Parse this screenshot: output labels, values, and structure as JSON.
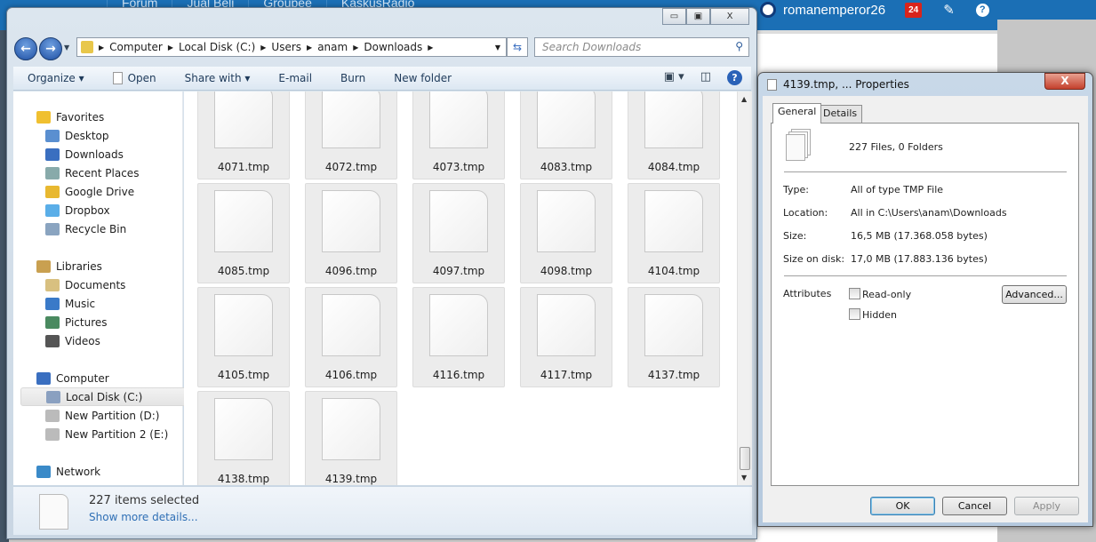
{
  "browser": {
    "nav": [
      "Forum",
      "Jual Beli",
      "Groupee",
      "KaskusRadio"
    ],
    "username": "romanemperor26",
    "notification_count": "24"
  },
  "explorer": {
    "caption_buttons": {
      "minimize": "▭",
      "maximize": "▣",
      "close": "X"
    },
    "breadcrumb": [
      "Computer",
      "Local Disk (C:)",
      "Users",
      "anam",
      "Downloads"
    ],
    "search_placeholder": "Search Downloads",
    "toolbar": [
      "Organize ▾",
      "Open",
      "Share with ▾",
      "E-mail",
      "Burn",
      "New folder"
    ],
    "nav": {
      "favorites_header": "Favorites",
      "favorites": [
        "Desktop",
        "Downloads",
        "Recent Places",
        "Google Drive",
        "Dropbox",
        "Recycle Bin"
      ],
      "libraries_header": "Libraries",
      "libraries": [
        "Documents",
        "Music",
        "Pictures",
        "Videos"
      ],
      "computer_header": "Computer",
      "drives": [
        "Local Disk (C:)",
        "New Partition (D:)",
        "New Partition 2 (E:)"
      ],
      "selected": "Local Disk (C:)",
      "network": "Network"
    },
    "files": [
      "4071.tmp",
      "4072.tmp",
      "4073.tmp",
      "4083.tmp",
      "4084.tmp",
      "4085.tmp",
      "4096.tmp",
      "4097.tmp",
      "4098.tmp",
      "4104.tmp",
      "4105.tmp",
      "4106.tmp",
      "4116.tmp",
      "4117.tmp",
      "4137.tmp",
      "4138.tmp",
      "4139.tmp"
    ],
    "details": {
      "count": "227 items selected",
      "more": "Show more details..."
    }
  },
  "properties": {
    "title": "4139.tmp, ... Properties",
    "close": "X",
    "tabs": [
      "General",
      "Details"
    ],
    "active_tab": "General",
    "summary": "227 Files, 0 Folders",
    "rows": [
      {
        "label": "Type:",
        "value": "All of type TMP File"
      },
      {
        "label": "Location:",
        "value": "All in C:\\Users\\anam\\Downloads"
      },
      {
        "label": "Size:",
        "value": "16,5 MB (17.368.058 bytes)"
      },
      {
        "label": "Size on disk:",
        "value": "17,0 MB (17.883.136 bytes)"
      }
    ],
    "attributes_label": "Attributes",
    "readonly": {
      "label": "Read-only",
      "checked": false
    },
    "hidden": {
      "label": "Hidden",
      "checked": false
    },
    "advanced": "Advanced...",
    "ok": "OK",
    "cancel": "Cancel",
    "apply": "Apply"
  }
}
